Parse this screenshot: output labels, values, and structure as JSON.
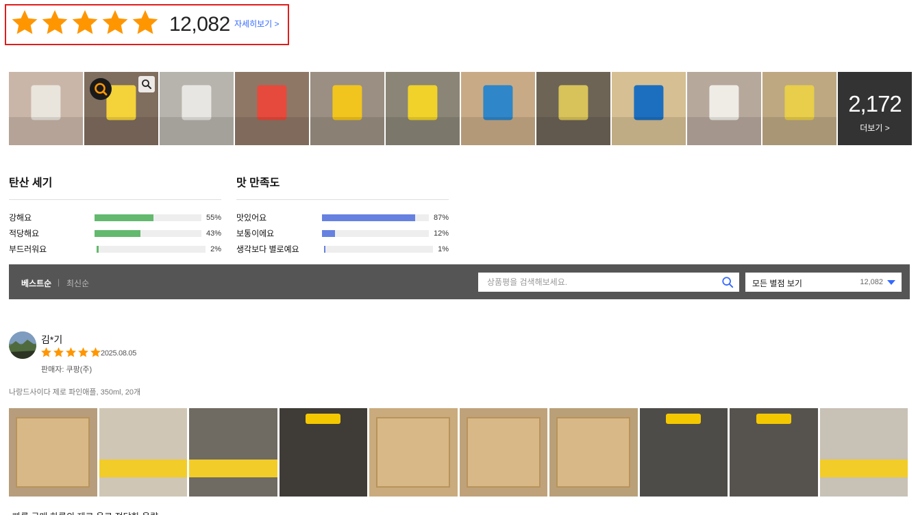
{
  "summary": {
    "rating": 5,
    "count": "12,082",
    "detail_link": "자세히보기 >"
  },
  "photo_strip": {
    "more_count": "2,172",
    "more_label": "더보기 >",
    "thumbs": [
      {
        "name": "glass-with-ice",
        "bg": "#c9b6a8",
        "accent": "#e9e4dc"
      },
      {
        "name": "narangd-bottle-hand",
        "bg": "#7f6d5e",
        "accent": "#f3d23a"
      },
      {
        "name": "bottle-closeup-top",
        "bg": "#b7b4ad",
        "accent": "#e8e6e2"
      },
      {
        "name": "bottle-label-korean",
        "bg": "#8f7766",
        "accent": "#e64a3c"
      },
      {
        "name": "bottle-label-back",
        "bg": "#9a8f82",
        "accent": "#f2c51e"
      },
      {
        "name": "bottle-label-yellow",
        "bg": "#8a8576",
        "accent": "#f0d22a"
      },
      {
        "name": "three-bottles-blue-caps",
        "bg": "#c8ab86",
        "accent": "#2f86c8"
      },
      {
        "name": "four-bottles-row",
        "bg": "#6d6456",
        "accent": "#d8c35a"
      },
      {
        "name": "cider-box-front",
        "bg": "#d5bf93",
        "accent": "#1c6fbf"
      },
      {
        "name": "glass-on-table",
        "bg": "#b7a89c",
        "accent": "#efece6"
      },
      {
        "name": "cider-box-350ml",
        "bg": "#bda882",
        "accent": "#e8ce4a"
      }
    ]
  },
  "surveys": [
    {
      "title": "탄산 세기",
      "color": "#63b96e",
      "rows": [
        {
          "label": "강해요",
          "percent": 55,
          "text": "55%"
        },
        {
          "label": "적당해요",
          "percent": 43,
          "text": "43%"
        },
        {
          "label": "부드러워요",
          "percent": 2,
          "text": "2%"
        }
      ]
    },
    {
      "title": "맛 만족도",
      "color": "#6681e0",
      "rows": [
        {
          "label": "맛있어요",
          "percent": 87,
          "text": "87%"
        },
        {
          "label": "보통이에요",
          "percent": 12,
          "text": "12%"
        },
        {
          "label": "생각보다 별로예요",
          "percent": 1,
          "text": "1%"
        }
      ]
    }
  ],
  "filter": {
    "sort_best": "베스트순",
    "sort_sep": "|",
    "sort_new": "최신순",
    "search_placeholder": "상품평을 검색해보세요.",
    "star_select_label": "모든 별점 보기",
    "star_select_count": "12,082"
  },
  "review": {
    "name": "김*기",
    "rating": 5,
    "date": "2025.08.05",
    "seller": "판매자: 쿠팡(주)",
    "product": "나랑드사이다 제로 파인애플, 350ml, 20개",
    "body": "빠른 구매 하루의 제로 음료 적당한 용량",
    "photos": [
      {
        "name": "open-box-bottles",
        "bg": "#b79d7c",
        "type": "box"
      },
      {
        "name": "narangd-cider-bottle",
        "bg": "#d0c6b5",
        "type": "band"
      },
      {
        "name": "bottle-label-red",
        "bg": "#6f6a62",
        "type": "band"
      },
      {
        "name": "yellow-cap-hand",
        "bg": "#3f3b36",
        "type": "cap"
      },
      {
        "name": "cider-box-side",
        "bg": "#c9ab7d",
        "type": "box"
      },
      {
        "name": "cider-box-top",
        "bg": "#bfa27a",
        "type": "box"
      },
      {
        "name": "box-350ml-20",
        "bg": "#b9a078",
        "type": "box"
      },
      {
        "name": "bottles-in-fridge",
        "bg": "#4e4c48",
        "type": "cap"
      },
      {
        "name": "bottles-fridge-shelf",
        "bg": "#56534f",
        "type": "cap"
      },
      {
        "name": "bottle-back-label",
        "bg": "#c8c1b6",
        "type": "band"
      }
    ]
  }
}
